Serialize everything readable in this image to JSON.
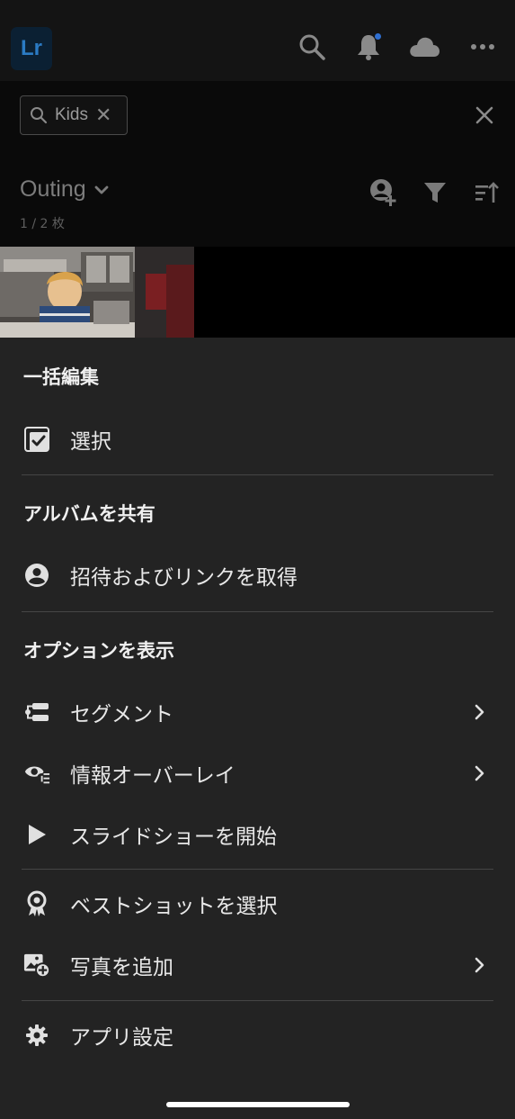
{
  "app": {
    "logo_text": "Lr",
    "brand_color": "#0b2033",
    "notification_dot_color": "#2f6fd1"
  },
  "topbar": {
    "icons": [
      "search-icon",
      "bell-icon",
      "cloud-icon",
      "more-icon"
    ]
  },
  "search": {
    "chip_text": "Kids",
    "clear_glyph": "✕"
  },
  "album": {
    "title": "Outing",
    "count": "1 / 2 枚",
    "icons": [
      "add-person-icon",
      "filter-icon",
      "sort-icon"
    ]
  },
  "sheet": {
    "sections": [
      {
        "header": "一括編集",
        "items": [
          {
            "label": "選択",
            "icon": "select-checkbox-icon",
            "chevron": false
          }
        ]
      },
      {
        "header": "アルバムを共有",
        "items": [
          {
            "label": "招待およびリンクを取得",
            "icon": "user-circle-icon",
            "chevron": false
          }
        ]
      },
      {
        "header": "オプションを表示",
        "items": [
          {
            "label": "セグメント",
            "icon": "segment-icon",
            "chevron": true
          },
          {
            "label": "情報オーバーレイ",
            "icon": "info-overlay-icon",
            "chevron": true
          },
          {
            "label": "スライドショーを開始",
            "icon": "play-icon",
            "chevron": false
          }
        ]
      },
      {
        "header": "",
        "items": [
          {
            "label": "ベストショットを選択",
            "icon": "award-icon",
            "chevron": false
          },
          {
            "label": "写真を追加",
            "icon": "add-photo-icon",
            "chevron": true
          }
        ]
      },
      {
        "header": "",
        "items": [
          {
            "label": "アプリ設定",
            "icon": "gear-icon",
            "chevron": false
          }
        ]
      }
    ]
  }
}
